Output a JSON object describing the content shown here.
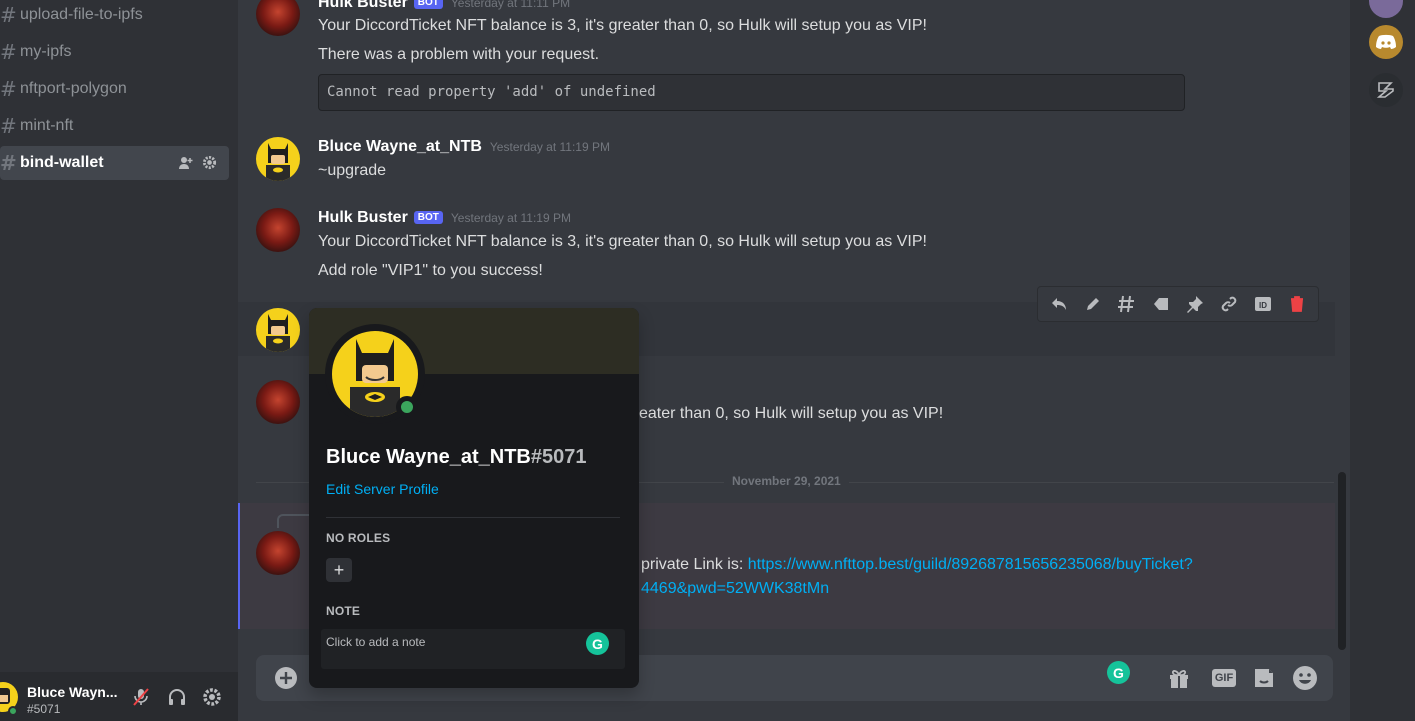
{
  "sidebar": {
    "channels": [
      {
        "label": "upload-file-to-ipfs"
      },
      {
        "label": "my-ipfs"
      },
      {
        "label": "nftport-polygon"
      },
      {
        "label": "mint-nft"
      },
      {
        "label": "bind-wallet",
        "active": true
      }
    ],
    "user": {
      "name": "Bluce Wayn...",
      "tag": "#5071"
    }
  },
  "messages": {
    "m1": {
      "author": "Hulk Buster",
      "bot_tag": "BOT",
      "timestamp": "Yesterday at 11:11 PM",
      "line1": "Your DiccordTicket NFT balance is 3, it's greater than 0, so Hulk will setup you as VIP!",
      "line2": "There was a problem with your request.",
      "code": "Cannot read property 'add' of undefined"
    },
    "m2": {
      "author": "Bluce Wayne_at_NTB",
      "timestamp": "Yesterday at 11:19 PM",
      "line1": "~upgrade"
    },
    "m3": {
      "author": "Hulk Buster",
      "bot_tag": "BOT",
      "timestamp": "Yesterday at 11:19 PM",
      "line1": "Your DiccordTicket NFT balance is 3, it's greater than 0, so Hulk will setup you as VIP!",
      "line2": "Add role \"VIP1\" to you success!"
    },
    "m5": {
      "line1_partial": "eater than 0, so Hulk will setup you as VIP!"
    },
    "date_divider": "November 29, 2021",
    "m6": {
      "prefix": "private Link is: ",
      "link_line1": "https://www.nfttop.best/guild/892687815656235068/buyTicket?",
      "link_line2": "4469&pwd=52WWK38tMn"
    }
  },
  "popout": {
    "username": "Bluce Wayne_at_NTB",
    "discriminator": "#5071",
    "edit_profile": "Edit Server Profile",
    "roles_heading": "NO ROLES",
    "add_role": "+",
    "note_heading": "NOTE",
    "note_placeholder": "Click to add a note"
  },
  "composer": {
    "gif_label": "GIF"
  },
  "colors": {
    "accent": "#5865f2",
    "link": "#00aff4",
    "online": "#3ba55d",
    "danger": "#ed4245"
  }
}
